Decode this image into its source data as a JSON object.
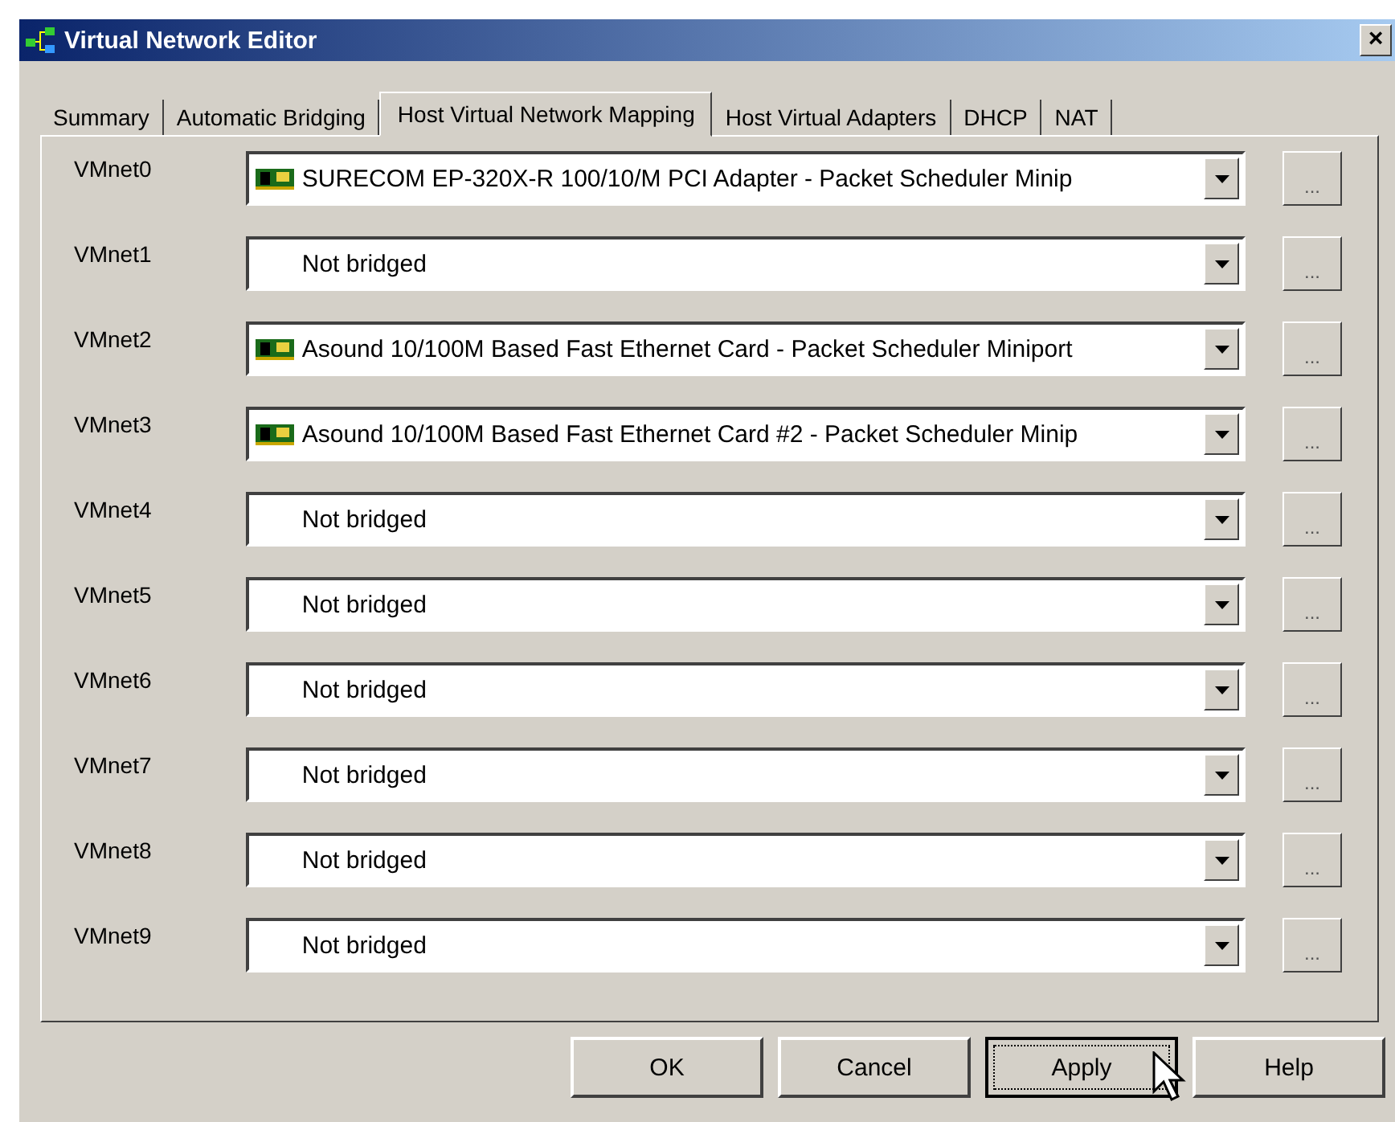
{
  "window": {
    "title": "Virtual Network Editor",
    "close": "×"
  },
  "tabs": [
    {
      "label": "Summary",
      "selected": false
    },
    {
      "label": "Automatic Bridging",
      "selected": false
    },
    {
      "label": "Host Virtual Network Mapping",
      "selected": true
    },
    {
      "label": "Host Virtual Adapters",
      "selected": false
    },
    {
      "label": "DHCP",
      "selected": false
    },
    {
      "label": "NAT",
      "selected": false
    }
  ],
  "mappings": [
    {
      "label": "VMnet0",
      "value": "SURECOM EP-320X-R 100/10/M PCI Adapter - Packet Scheduler Minip",
      "kind": "adapter",
      "more": "..."
    },
    {
      "label": "VMnet1",
      "value": "Not bridged",
      "kind": "none",
      "more": "..."
    },
    {
      "label": "VMnet2",
      "value": "Asound 10/100M Based Fast Ethernet Card - Packet Scheduler Miniport",
      "kind": "adapter",
      "more": "..."
    },
    {
      "label": "VMnet3",
      "value": "Asound 10/100M Based Fast Ethernet Card #2 - Packet Scheduler Minip",
      "kind": "adapter",
      "more": "..."
    },
    {
      "label": "VMnet4",
      "value": "Not bridged",
      "kind": "none",
      "more": "..."
    },
    {
      "label": "VMnet5",
      "value": "Not bridged",
      "kind": "none",
      "more": "..."
    },
    {
      "label": "VMnet6",
      "value": "Not bridged",
      "kind": "none",
      "more": "..."
    },
    {
      "label": "VMnet7",
      "value": "Not bridged",
      "kind": "none",
      "more": "..."
    },
    {
      "label": "VMnet8",
      "value": "Not bridged",
      "kind": "none",
      "more": "..."
    },
    {
      "label": "VMnet9",
      "value": "Not bridged",
      "kind": "none",
      "more": "..."
    }
  ],
  "buttons": [
    {
      "label": "OK",
      "focused": false
    },
    {
      "label": "Cancel",
      "focused": false
    },
    {
      "label": "Apply",
      "focused": true
    },
    {
      "label": "Help",
      "focused": false
    }
  ]
}
